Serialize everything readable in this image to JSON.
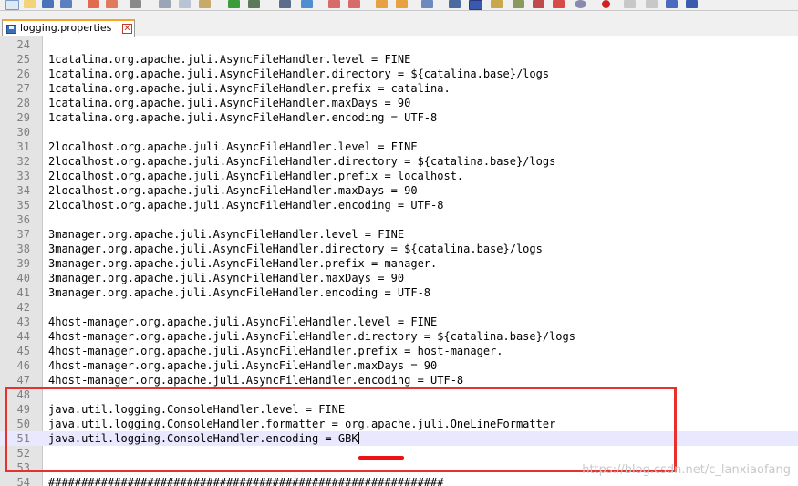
{
  "tab": {
    "label": "logging.properties",
    "close_glyph": "✕"
  },
  "lines": [
    {
      "n": "24",
      "t": ""
    },
    {
      "n": "25",
      "t": "1catalina.org.apache.juli.AsyncFileHandler.level = FINE"
    },
    {
      "n": "26",
      "t": "1catalina.org.apache.juli.AsyncFileHandler.directory = ${catalina.base}/logs"
    },
    {
      "n": "27",
      "t": "1catalina.org.apache.juli.AsyncFileHandler.prefix = catalina."
    },
    {
      "n": "28",
      "t": "1catalina.org.apache.juli.AsyncFileHandler.maxDays = 90"
    },
    {
      "n": "29",
      "t": "1catalina.org.apache.juli.AsyncFileHandler.encoding = UTF-8"
    },
    {
      "n": "30",
      "t": ""
    },
    {
      "n": "31",
      "t": "2localhost.org.apache.juli.AsyncFileHandler.level = FINE"
    },
    {
      "n": "32",
      "t": "2localhost.org.apache.juli.AsyncFileHandler.directory = ${catalina.base}/logs"
    },
    {
      "n": "33",
      "t": "2localhost.org.apache.juli.AsyncFileHandler.prefix = localhost."
    },
    {
      "n": "34",
      "t": "2localhost.org.apache.juli.AsyncFileHandler.maxDays = 90"
    },
    {
      "n": "35",
      "t": "2localhost.org.apache.juli.AsyncFileHandler.encoding = UTF-8"
    },
    {
      "n": "36",
      "t": ""
    },
    {
      "n": "37",
      "t": "3manager.org.apache.juli.AsyncFileHandler.level = FINE"
    },
    {
      "n": "38",
      "t": "3manager.org.apache.juli.AsyncFileHandler.directory = ${catalina.base}/logs"
    },
    {
      "n": "39",
      "t": "3manager.org.apache.juli.AsyncFileHandler.prefix = manager."
    },
    {
      "n": "40",
      "t": "3manager.org.apache.juli.AsyncFileHandler.maxDays = 90"
    },
    {
      "n": "41",
      "t": "3manager.org.apache.juli.AsyncFileHandler.encoding = UTF-8"
    },
    {
      "n": "42",
      "t": ""
    },
    {
      "n": "43",
      "t": "4host-manager.org.apache.juli.AsyncFileHandler.level = FINE"
    },
    {
      "n": "44",
      "t": "4host-manager.org.apache.juli.AsyncFileHandler.directory = ${catalina.base}/logs"
    },
    {
      "n": "45",
      "t": "4host-manager.org.apache.juli.AsyncFileHandler.prefix = host-manager."
    },
    {
      "n": "46",
      "t": "4host-manager.org.apache.juli.AsyncFileHandler.maxDays = 90"
    },
    {
      "n": "47",
      "t": "4host-manager.org.apache.juli.AsyncFileHandler.encoding = UTF-8"
    },
    {
      "n": "48",
      "t": ""
    },
    {
      "n": "49",
      "t": "java.util.logging.ConsoleHandler.level = FINE"
    },
    {
      "n": "50",
      "t": "java.util.logging.ConsoleHandler.formatter = org.apache.juli.OneLineFormatter"
    },
    {
      "n": "51",
      "t": "java.util.logging.ConsoleHandler.encoding = GBK",
      "current": true
    },
    {
      "n": "52",
      "t": ""
    },
    {
      "n": "53",
      "t": ""
    },
    {
      "n": "54",
      "t": "############################################################"
    }
  ],
  "watermark": "https://blog.csdn.net/c_lanxiaofang",
  "colors": {
    "highlight": "#e8312e",
    "current_line": "#e8e8ff",
    "gutter": "#e4e4e4"
  }
}
